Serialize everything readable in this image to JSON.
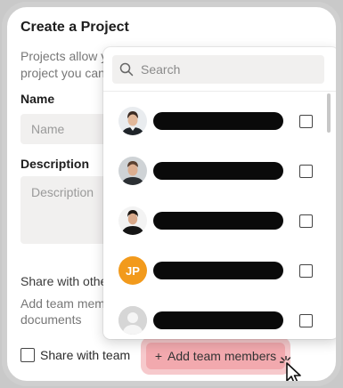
{
  "form": {
    "title": "Create a Project",
    "description_line1": "Projects allow you to bring teams and documents together. Everyone on the",
    "description_line2": "project you can invite people to collaborate on it and they will get access to everything",
    "name_label": "Name",
    "name_placeholder": "Name",
    "description_label": "Description",
    "description_placeholder": "Description",
    "share_label": "Share with others",
    "share_help_line1": "Add team members who should have access to this project and its",
    "share_help_line2": "documents",
    "share_with_team_label": "Share with team",
    "add_team_members_label": "Add team members",
    "add_team_members_icon": "plus-icon"
  },
  "member_picker": {
    "search_placeholder": "Search",
    "search_icon": "search-icon",
    "members": [
      {
        "avatar_type": "photo",
        "initials": "",
        "checked": false
      },
      {
        "avatar_type": "photo",
        "initials": "",
        "checked": false
      },
      {
        "avatar_type": "photo",
        "initials": "",
        "checked": false
      },
      {
        "avatar_type": "initials",
        "initials": "JP",
        "checked": false
      },
      {
        "avatar_type": "placeholder",
        "initials": "",
        "checked": false
      }
    ]
  },
  "colors": {
    "button_bg": "#f2a9ae",
    "button_halo": "#f6c9cc",
    "initials_avatar": "#f29a1c"
  }
}
